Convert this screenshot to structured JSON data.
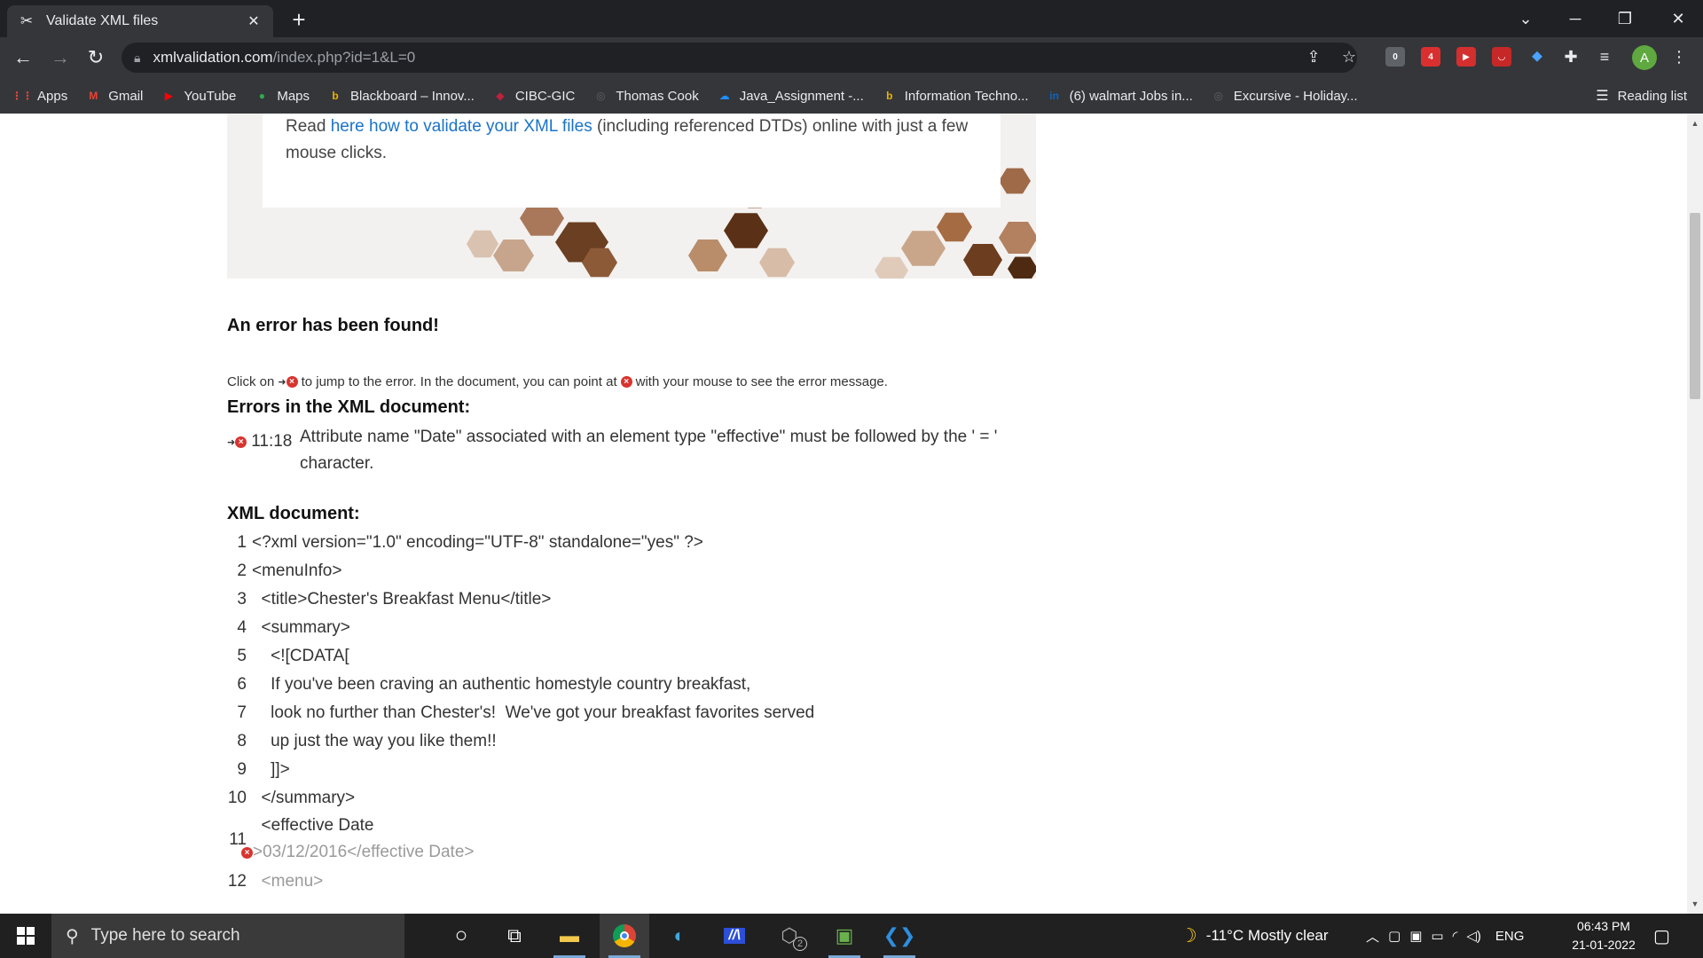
{
  "browser": {
    "tab_title": "Validate XML files",
    "tab_close": "✕",
    "new_tab": "+",
    "url_host": "xmlvalidation.com",
    "url_path": "/index.php?id=1&L=0",
    "ext_badges": [
      "0",
      "4"
    ],
    "avatar_letter": "A"
  },
  "bookmarks": [
    {
      "label": "Apps",
      "icon": "apps-grid-icon",
      "color": "#e8453c",
      "glyph": "⋮⋮"
    },
    {
      "label": "Gmail",
      "icon": "gmail-icon",
      "color": "#ea4335",
      "glyph": "M"
    },
    {
      "label": "YouTube",
      "icon": "youtube-icon",
      "color": "#ff0000",
      "glyph": "▶"
    },
    {
      "label": "Maps",
      "icon": "maps-icon",
      "color": "#34a853",
      "glyph": "●"
    },
    {
      "label": "Blackboard – Innov...",
      "icon": "blackboard-icon",
      "color": "#e8b400",
      "glyph": "b"
    },
    {
      "label": "CIBC-GIC",
      "icon": "cibc-icon",
      "color": "#c41f3e",
      "glyph": "◆"
    },
    {
      "label": "Thomas Cook",
      "icon": "globe-icon",
      "color": "#5f6368",
      "glyph": "◎"
    },
    {
      "label": "Java_Assignment -...",
      "icon": "onedrive-icon",
      "color": "#1e90ff",
      "glyph": "☁"
    },
    {
      "label": "Information Techno...",
      "icon": "blackboard-icon",
      "color": "#e8b400",
      "glyph": "b"
    },
    {
      "label": "(6) walmart Jobs in...",
      "icon": "linkedin-icon",
      "color": "#0a66c2",
      "glyph": "in"
    },
    {
      "label": "Excursive - Holiday...",
      "icon": "globe-icon",
      "color": "#5f6368",
      "glyph": "◎"
    }
  ],
  "reading_list": "Reading list",
  "page": {
    "intro_before": "Read ",
    "intro_link": "here how to validate your XML files",
    "intro_after": " (including referenced DTDs) online with just a few mouse clicks.",
    "error_found": "An error has been found!",
    "hint_a": "Click on ",
    "hint_b": " to jump to the error. In the document, you can point at ",
    "hint_c": " with your mouse to see the error message.",
    "errors_heading": "Errors in the XML document:",
    "error_loc": "11:18",
    "error_msg": "Attribute name \"Date\" associated with an element type \"effective\" must be followed by the ' = ' character.",
    "xml_heading": "XML document:",
    "xml_lines": [
      {
        "n": "1",
        "text": "<?xml version=\"1.0\" encoding=\"UTF-8\" standalone=\"yes\" ?>"
      },
      {
        "n": "2",
        "text": "<menuInfo>"
      },
      {
        "n": "3",
        "text": "  <title>Chester's Breakfast Menu</title>"
      },
      {
        "n": "4",
        "text": "  <summary>"
      },
      {
        "n": "5",
        "text": "    <![CDATA["
      },
      {
        "n": "6",
        "text": "    If you've been craving an authentic homestyle country breakfast,"
      },
      {
        "n": "7",
        "text": "    look no further than Chester's!  We've got your breakfast favorites served"
      },
      {
        "n": "8",
        "text": "    up just the way you like them!!"
      },
      {
        "n": "9",
        "text": "    ]]>"
      },
      {
        "n": "10",
        "text": "  </summary>"
      },
      {
        "n": "11",
        "text": "  <effective Date",
        "tail": ">03/12/2016</effective Date>"
      },
      {
        "n": "12",
        "text": "  <menu>"
      }
    ]
  },
  "taskbar": {
    "search_placeholder": "Type here to search",
    "weather": "-11°C  Mostly clear",
    "lang": "ENG",
    "time": "06:43 PM",
    "date": "21-01-2022",
    "badge": "2"
  }
}
